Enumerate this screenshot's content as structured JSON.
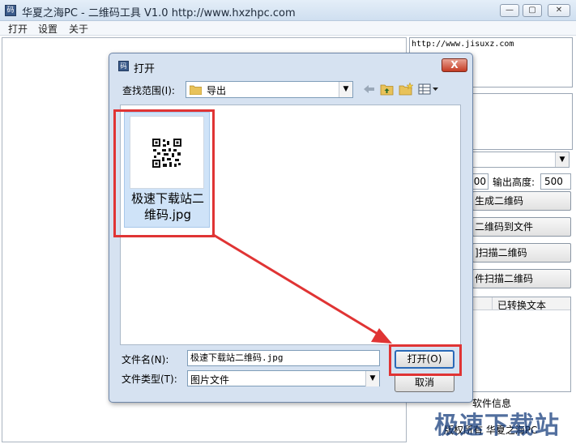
{
  "window": {
    "title": "华夏之海PC - 二维码工具 V1.0  http://www.hxzhpc.com",
    "icon_name": "qr-app-icon",
    "min_label": "▭",
    "max_label": "▢",
    "close_label": "✕"
  },
  "menu": {
    "items": [
      "打开",
      "设置",
      "关于"
    ]
  },
  "right_panel": {
    "url_text": "http://www.jisuxz.com",
    "width_value": "00",
    "height_label": "输出高度:",
    "height_value": "500",
    "buttons": [
      "生成二维码",
      "存二维码到文件",
      "截图扫描二维码",
      "文件扫描二维码"
    ],
    "button_visible": [
      "生成二维码",
      "二维码到文件",
      "]扫描二维码",
      "件扫描二维码"
    ],
    "table_header": "已转换文本",
    "info_label": "软件信息",
    "copyright": "版权所有 华夏之海PC"
  },
  "watermark": "极速下载站",
  "dialog": {
    "title": "打开",
    "close_label": "X",
    "look_in_label": "查找范围(I):",
    "look_in_value": "导出",
    "file": {
      "name_line1": "极速下载站二",
      "name_line2": "维码.jpg"
    },
    "file_name_label": "文件名(N):",
    "file_name_value": "极速下载站二维码.jpg",
    "file_type_label": "文件类型(T):",
    "file_type_value": "图片文件",
    "open_button": "打开(O)",
    "cancel_button": "取消"
  },
  "colors": {
    "highlight": "#e03434",
    "title_bg": "#d6e2f1",
    "selection": "#cfe3f8"
  }
}
